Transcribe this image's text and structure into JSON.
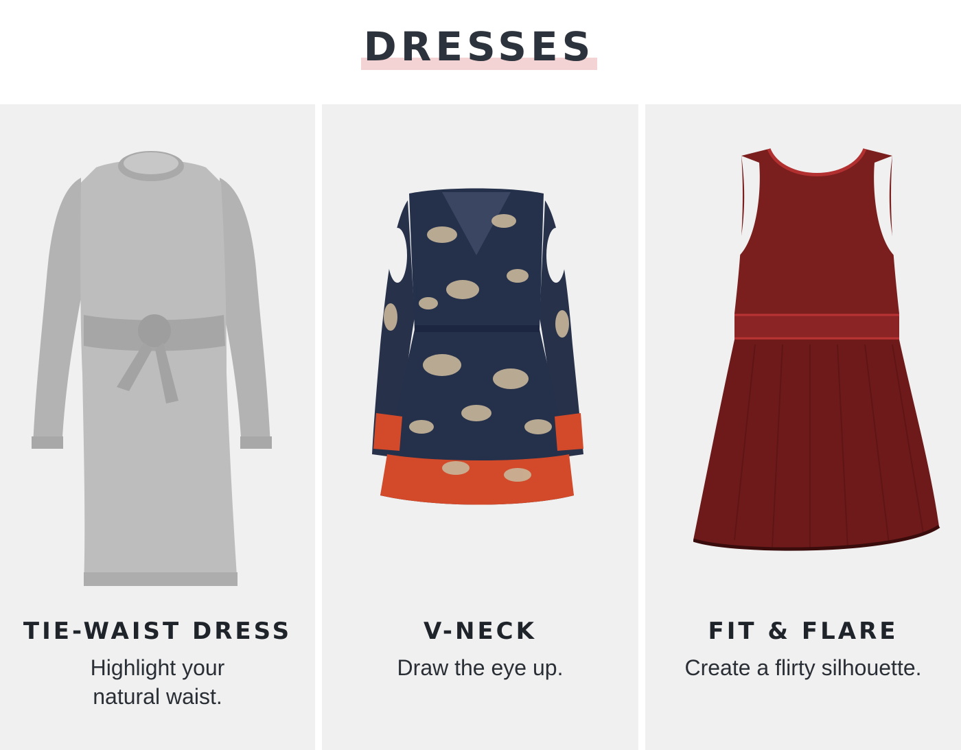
{
  "header": {
    "title": "DRESSES",
    "accent_color": "#f3d3d3",
    "title_color": "#2d333c"
  },
  "products": [
    {
      "name": "TIE-WAIST DRESS",
      "description_lines": [
        "Highlight your",
        "natural waist."
      ],
      "image_icon": "gray-tie-waist-sweater-dress-image",
      "color": "#b9b9b9"
    },
    {
      "name": "V-NECK",
      "description_lines": [
        "Draw the eye up."
      ],
      "image_icon": "navy-floral-cold-shoulder-dress-image",
      "color": "#25304a"
    },
    {
      "name": "FIT & FLARE",
      "description_lines": [
        "Create a flirty silhouette."
      ],
      "image_icon": "burgundy-knit-fit-and-flare-dress-image",
      "color": "#7a1e1e"
    }
  ]
}
